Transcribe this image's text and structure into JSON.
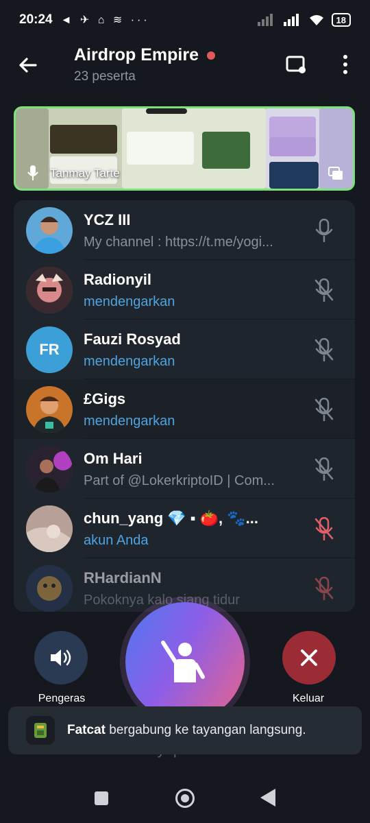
{
  "status_bar": {
    "time": "20:24",
    "notifications": "◄ ✈ ⌂ ≋ ···",
    "battery": "18"
  },
  "header": {
    "title": "Airdrop Empire",
    "subtitle": "23 peserta"
  },
  "video": {
    "speaker_name": "Tanmay Tarte"
  },
  "participants": [
    {
      "name": "YCZ III",
      "status": "My channel : https://t.me/yogi...",
      "status_style": "grey",
      "mic": "active",
      "avatar_color": "#5fa8d8",
      "initials": ""
    },
    {
      "name": "Radionyil",
      "status": "mendengarkan",
      "status_style": "blue",
      "mic": "muted",
      "avatar_color": "#8a5a52",
      "initials": ""
    },
    {
      "name": "Fauzi Rosyad",
      "status": "mendengarkan",
      "status_style": "blue",
      "mic": "muted",
      "avatar_color": "#3d9fd8",
      "initials": "FR"
    },
    {
      "name": "£Gigs",
      "status": "mendengarkan",
      "status_style": "blue",
      "mic": "muted",
      "avatar_color": "#c9742a",
      "initials": ""
    },
    {
      "name": "Om Hari",
      "status": "Part of @LokerkriptoID | Com...",
      "status_style": "grey",
      "mic": "muted",
      "avatar_color": "#6a4a8a",
      "initials": ""
    },
    {
      "name": "chun_yang 💎 ▪ 🍅, 🐾...",
      "status": "akun Anda",
      "status_style": "blue",
      "mic": "muted-red",
      "avatar_color": "#c9b3a8",
      "initials": ""
    },
    {
      "name": "RHardianN",
      "status": "Pokoknya kalo siang tidur",
      "status_style": "grey",
      "mic": "muted-red",
      "avatar_color": "#2b3a5c",
      "initials": ""
    }
  ],
  "controls": {
    "speaker_label": "Pengeras",
    "leave_label": "Keluar",
    "muted_text": "Disenyapkan admin"
  },
  "toast": {
    "user": "Fatcat",
    "message": " bergabung ke tayangan langsung."
  },
  "colors": {
    "background": "#15191f",
    "list_bg": "#1f252d",
    "link_blue": "#4fa3e0",
    "leave_red": "#9b2c36",
    "muted_red": "#e0606a",
    "video_border": "#7ee07b"
  }
}
